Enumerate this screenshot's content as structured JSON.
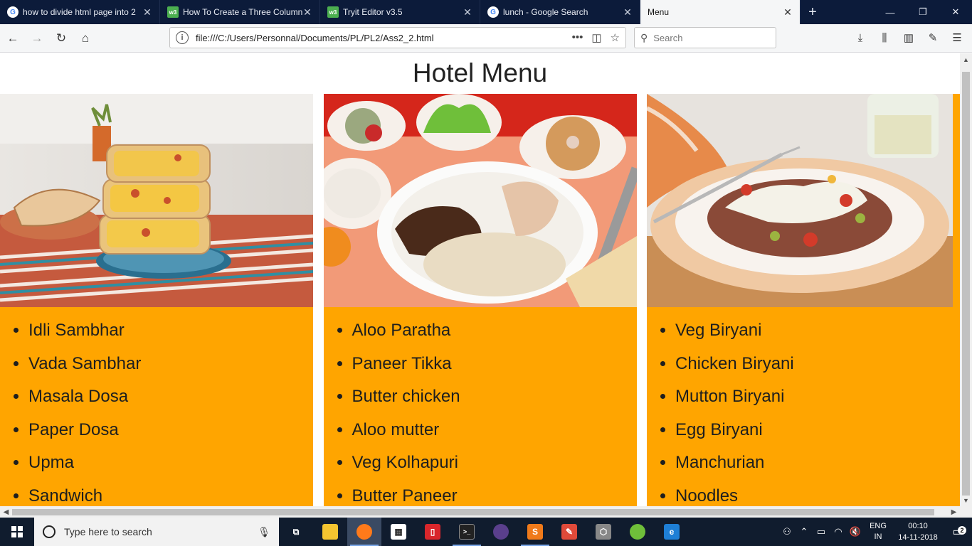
{
  "browser": {
    "tabs": [
      {
        "title": "how to divide html page into 2",
        "favicon": "google-icon"
      },
      {
        "title": "How To Create a Three Column",
        "favicon": "w3schools-icon"
      },
      {
        "title": "Tryit Editor v3.5",
        "favicon": "w3schools-icon"
      },
      {
        "title": "lunch - Google Search",
        "favicon": "google-icon"
      },
      {
        "title": "Menu",
        "favicon": "none"
      }
    ],
    "new_tab": "+",
    "url": "file:///C:/Users/Personnal/Documents/PL/PL2/Ass2_2.html",
    "search_placeholder": "Search"
  },
  "page": {
    "title": "Hotel Menu",
    "columns": [
      {
        "image": "wrap-sandwich-photo",
        "items": [
          "Idli Sambhar",
          "Vada Sambhar",
          "Masala Dosa",
          "Paper Dosa",
          "Upma",
          "Sandwich"
        ]
      },
      {
        "image": "lunch-tray-photo",
        "items": [
          "Aloo Paratha",
          "Paneer Tikka",
          "Butter chicken",
          "Aloo mutter",
          "Veg Kolhapuri",
          "Butter Paneer"
        ]
      },
      {
        "image": "plated-dish-photo",
        "items": [
          "Veg Biryani",
          "Chicken Biryani",
          "Mutton Biryani",
          "Egg Biryani",
          "Manchurian",
          "Noodles"
        ]
      }
    ],
    "accent_color": "#ffa500"
  },
  "taskbar": {
    "search_placeholder": "Type here to search",
    "language_line1": "ENG",
    "language_line2": "IN",
    "time": "00:10",
    "date": "14-11-2018",
    "notification_count": "2"
  }
}
